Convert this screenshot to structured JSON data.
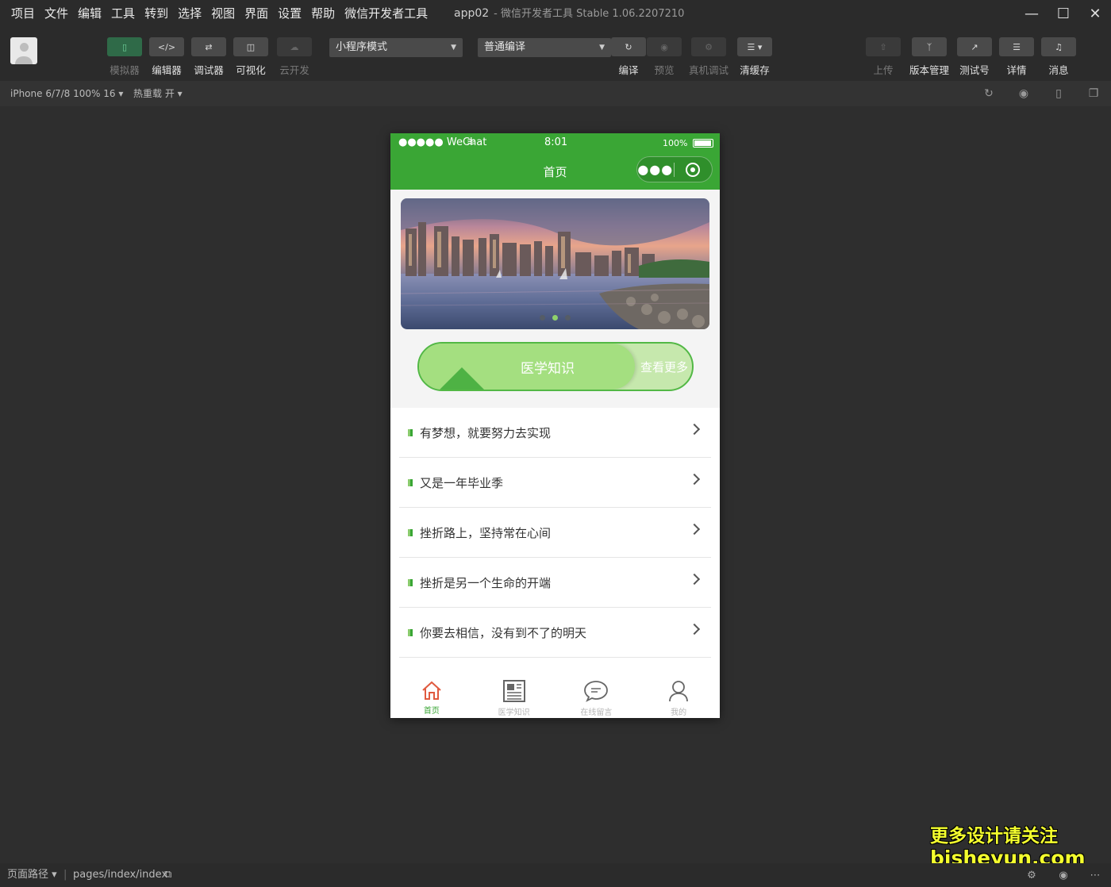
{
  "menu": [
    "项目",
    "文件",
    "编辑",
    "工具",
    "转到",
    "选择",
    "视图",
    "界面",
    "设置",
    "帮助",
    "微信开发者工具"
  ],
  "window": {
    "app": "app02",
    "title": "- 微信开发者工具 Stable 1.06.2207210"
  },
  "toolbar": {
    "simulator": "模拟器",
    "editor": "编辑器",
    "debugger": "调试器",
    "visual": "可视化",
    "cloud": "云开发",
    "mode_select": "小程序模式",
    "compile_select": "普通编译",
    "compile": "编译",
    "preview": "预览",
    "remote_debug": "真机调试",
    "clear_cache": "清缓存",
    "upload": "上传",
    "version": "版本管理",
    "test_account": "测试号",
    "details": "详情",
    "messages": "消息"
  },
  "subbar": {
    "device": "iPhone 6/7/8 100% 16 ▾",
    "hot_reload": "热重载 开 ▾"
  },
  "phone": {
    "carrier": "●●●●● WeChat",
    "time": "8:01",
    "battery": "100%",
    "page_title": "首页",
    "banner_active_index": 1,
    "knowledge_main": "医学知识",
    "knowledge_more": "查看更多",
    "articles": [
      "有梦想，就要努力去实现",
      "又是一年毕业季",
      "挫折路上，坚持常在心间",
      "挫折是另一个生命的开端",
      "你要去相信，没有到不了的明天"
    ],
    "tabs": [
      {
        "label": "首页",
        "icon": "home-icon"
      },
      {
        "label": "医学知识",
        "icon": "newspaper-icon"
      },
      {
        "label": "在线留言",
        "icon": "chat-bubble-icon"
      },
      {
        "label": "我的",
        "icon": "user-icon"
      }
    ]
  },
  "bottombar": {
    "path_label": "页面路径 ▾",
    "path": "pages/index/index"
  },
  "watermark": {
    "line1": "更多设计请关注",
    "line2": "bisheyun.com"
  },
  "colors": {
    "brand_green": "#3aa635",
    "dark_bg": "#2e2e2e"
  }
}
